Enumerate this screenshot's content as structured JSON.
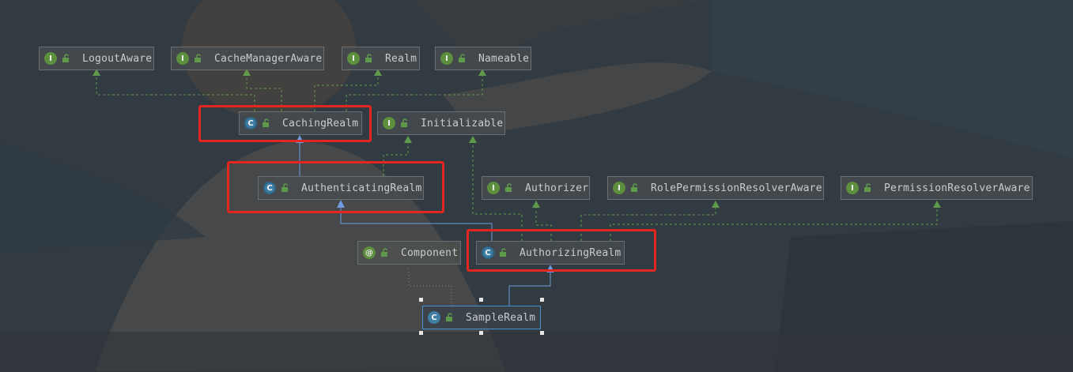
{
  "diagram": {
    "nodes": [
      {
        "id": "LogoutAware",
        "kind": "I",
        "type": "interface",
        "label": "LogoutAware"
      },
      {
        "id": "CacheManagerAware",
        "kind": "I",
        "type": "interface",
        "label": "CacheManagerAware"
      },
      {
        "id": "Realm",
        "kind": "I",
        "type": "interface",
        "label": "Realm"
      },
      {
        "id": "Nameable",
        "kind": "I",
        "type": "interface",
        "label": "Nameable"
      },
      {
        "id": "CachingRealm",
        "kind": "C",
        "type": "abstract-class",
        "label": "CachingRealm"
      },
      {
        "id": "Initializable",
        "kind": "I",
        "type": "interface",
        "label": "Initializable"
      },
      {
        "id": "AuthenticatingRealm",
        "kind": "C",
        "type": "abstract-class",
        "label": "AuthenticatingRealm"
      },
      {
        "id": "Authorizer",
        "kind": "I",
        "type": "interface",
        "label": "Authorizer"
      },
      {
        "id": "RolePermissionResolverAware",
        "kind": "I",
        "type": "interface",
        "label": "RolePermissionResolverAware"
      },
      {
        "id": "PermissionResolverAware",
        "kind": "I",
        "type": "interface",
        "label": "PermissionResolverAware"
      },
      {
        "id": "Component",
        "kind": "@",
        "type": "annotation",
        "label": "Component"
      },
      {
        "id": "AuthorizingRealm",
        "kind": "C",
        "type": "abstract-class",
        "label": "AuthorizingRealm"
      },
      {
        "id": "SampleRealm",
        "kind": "C",
        "type": "class",
        "label": "SampleRealm"
      }
    ],
    "edges": [
      {
        "from": "CachingRealm",
        "to": "LogoutAware",
        "relation": "implements"
      },
      {
        "from": "CachingRealm",
        "to": "CacheManagerAware",
        "relation": "implements"
      },
      {
        "from": "CachingRealm",
        "to": "Realm",
        "relation": "implements"
      },
      {
        "from": "CachingRealm",
        "to": "Nameable",
        "relation": "implements"
      },
      {
        "from": "AuthenticatingRealm",
        "to": "CachingRealm",
        "relation": "extends"
      },
      {
        "from": "AuthenticatingRealm",
        "to": "Initializable",
        "relation": "implements"
      },
      {
        "from": "AuthorizingRealm",
        "to": "AuthenticatingRealm",
        "relation": "extends"
      },
      {
        "from": "AuthorizingRealm",
        "to": "Initializable",
        "relation": "implements"
      },
      {
        "from": "AuthorizingRealm",
        "to": "Authorizer",
        "relation": "implements"
      },
      {
        "from": "AuthorizingRealm",
        "to": "RolePermissionResolverAware",
        "relation": "implements"
      },
      {
        "from": "AuthorizingRealm",
        "to": "PermissionResolverAware",
        "relation": "implements"
      },
      {
        "from": "SampleRealm",
        "to": "AuthorizingRealm",
        "relation": "extends"
      },
      {
        "from": "SampleRealm",
        "to": "Component",
        "relation": "annotated-with"
      }
    ],
    "highlighted": [
      "CachingRealm",
      "AuthenticatingRealm",
      "AuthorizingRealm"
    ],
    "selected": "SampleRealm",
    "colors": {
      "extends_edge": "#6f9be0",
      "implements_edge": "#5f9a4a",
      "annotation_edge": "#8a8a6a",
      "highlight": "#e3261f",
      "selection": "#4a8fd0"
    }
  }
}
